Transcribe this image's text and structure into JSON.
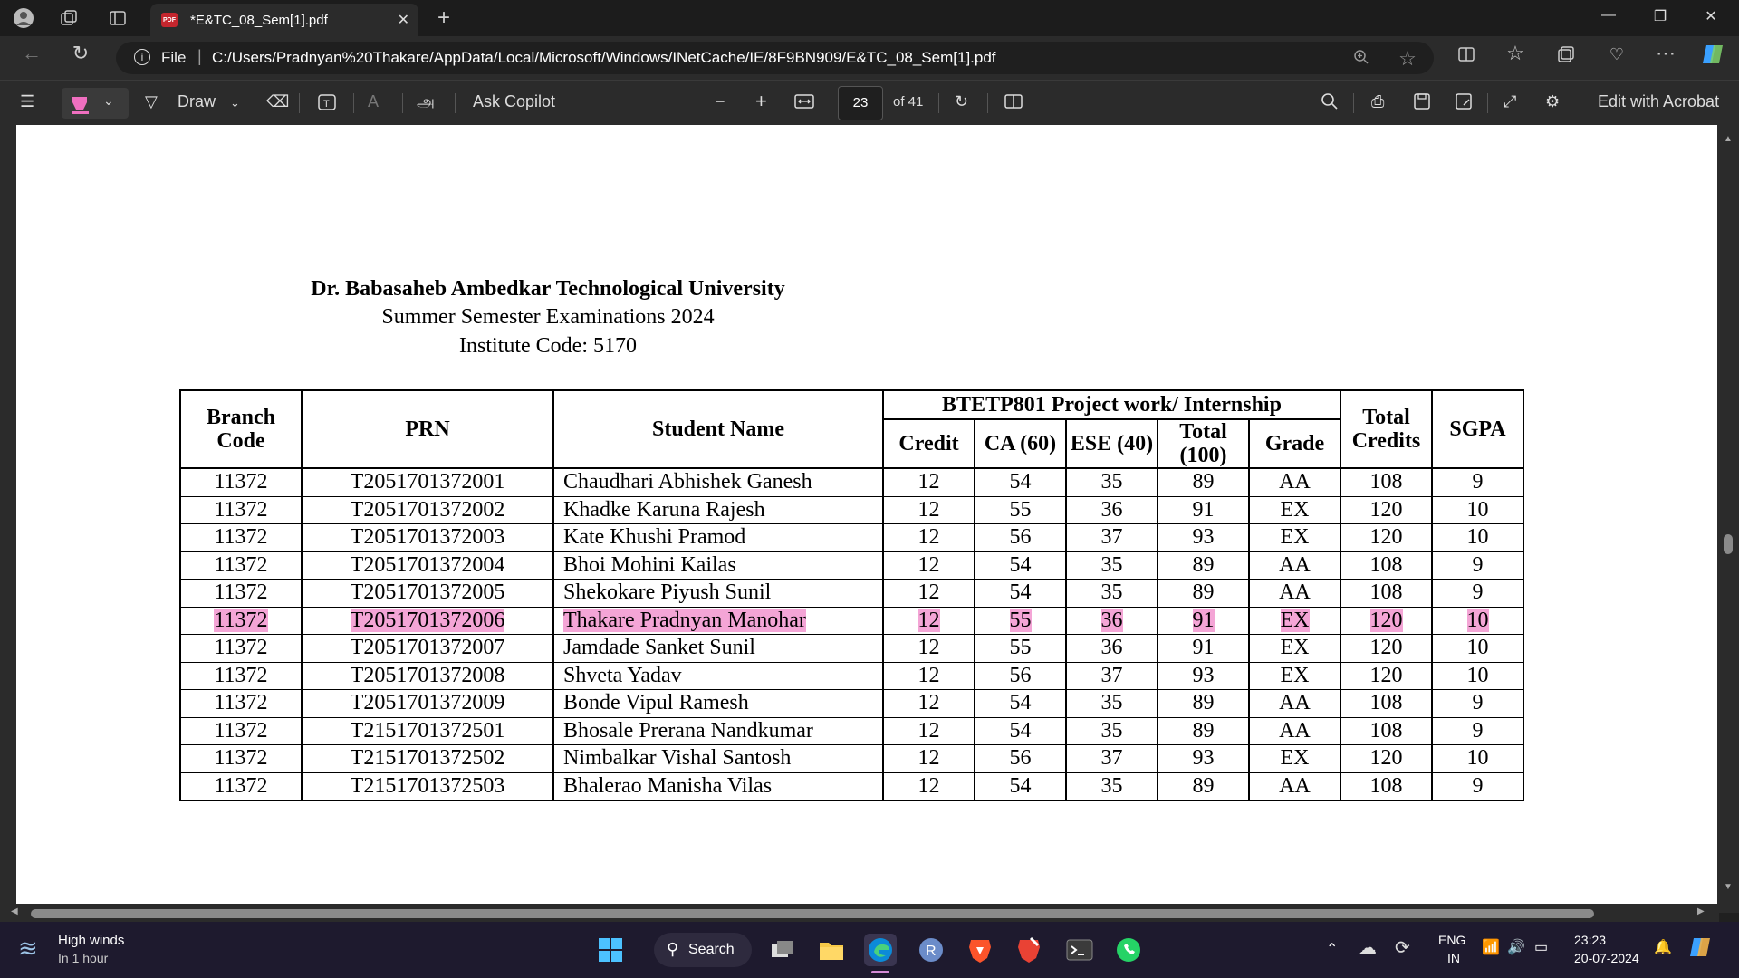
{
  "browser": {
    "tab_title": "*E&TC_08_Sem[1].pdf",
    "address_scheme_label": "File",
    "url": "C:/Users/Pradnyan%20Thakare/AppData/Local/Microsoft/Windows/INetCache/IE/8F9BN909/E&TC_08_Sem[1].pdf"
  },
  "pdf_toolbar": {
    "draw_label": "Draw",
    "ask_copilot_label": "Ask Copilot",
    "page_number": "23",
    "page_total": "of 41",
    "edit_acrobat_label": "Edit with Acrobat"
  },
  "document": {
    "title": "Dr. Babasaheb Ambedkar Technological University",
    "subtitle1": "Summer Semester Examinations 2024",
    "subtitle2": "Institute Code: 5170",
    "headers": {
      "branch_code": "Branch Code",
      "prn": "PRN",
      "student_name": "Student Name",
      "course": "BTETP801 Project work/ Internship",
      "credit": "Credit",
      "ca": "CA (60)",
      "ese": "ESE (40)",
      "total": "Total (100)",
      "grade": "Grade",
      "total_credits": "Total Credits",
      "sgpa": "SGPA"
    },
    "rows": [
      {
        "branch": "11372",
        "prn": "T2051701372001",
        "name": "Chaudhari Abhishek Ganesh",
        "credit": "12",
        "ca": "54",
        "ese": "35",
        "total": "89",
        "grade": "AA",
        "total_credits": "108",
        "sgpa": "9"
      },
      {
        "branch": "11372",
        "prn": "T2051701372002",
        "name": "Khadke Karuna Rajesh",
        "credit": "12",
        "ca": "55",
        "ese": "36",
        "total": "91",
        "grade": "EX",
        "total_credits": "120",
        "sgpa": "10"
      },
      {
        "branch": "11372",
        "prn": "T2051701372003",
        "name": "Kate Khushi Pramod",
        "credit": "12",
        "ca": "56",
        "ese": "37",
        "total": "93",
        "grade": "EX",
        "total_credits": "120",
        "sgpa": "10"
      },
      {
        "branch": "11372",
        "prn": "T2051701372004",
        "name": "Bhoi Mohini Kailas",
        "credit": "12",
        "ca": "54",
        "ese": "35",
        "total": "89",
        "grade": "AA",
        "total_credits": "108",
        "sgpa": "9"
      },
      {
        "branch": "11372",
        "prn": "T2051701372005",
        "name": "Shekokare Piyush Sunil",
        "credit": "12",
        "ca": "54",
        "ese": "35",
        "total": "89",
        "grade": "AA",
        "total_credits": "108",
        "sgpa": "9"
      },
      {
        "branch": "11372",
        "prn": "T2051701372006",
        "name": "Thakare Pradnyan Manohar",
        "credit": "12",
        "ca": "55",
        "ese": "36",
        "total": "91",
        "grade": "EX",
        "total_credits": "120",
        "sgpa": "10",
        "highlighted": true
      },
      {
        "branch": "11372",
        "prn": "T2051701372007",
        "name": "Jamdade Sanket Sunil",
        "credit": "12",
        "ca": "55",
        "ese": "36",
        "total": "91",
        "grade": "EX",
        "total_credits": "120",
        "sgpa": "10"
      },
      {
        "branch": "11372",
        "prn": "T2051701372008",
        "name": "Shveta Yadav",
        "credit": "12",
        "ca": "56",
        "ese": "37",
        "total": "93",
        "grade": "EX",
        "total_credits": "120",
        "sgpa": "10"
      },
      {
        "branch": "11372",
        "prn": "T2051701372009",
        "name": "Bonde Vipul Ramesh",
        "credit": "12",
        "ca": "54",
        "ese": "35",
        "total": "89",
        "grade": "AA",
        "total_credits": "108",
        "sgpa": "9"
      },
      {
        "branch": "11372",
        "prn": "T2151701372501",
        "name": "Bhosale Prerana Nandkumar",
        "credit": "12",
        "ca": "54",
        "ese": "35",
        "total": "89",
        "grade": "AA",
        "total_credits": "108",
        "sgpa": "9"
      },
      {
        "branch": "11372",
        "prn": "T2151701372502",
        "name": "Nimbalkar Vishal Santosh",
        "credit": "12",
        "ca": "56",
        "ese": "37",
        "total": "93",
        "grade": "EX",
        "total_credits": "120",
        "sgpa": "10"
      },
      {
        "branch": "11372",
        "prn": "T2151701372503",
        "name": "Bhalerao Manisha Vilas",
        "credit": "12",
        "ca": "54",
        "ese": "35",
        "total": "89",
        "grade": "AA",
        "total_credits": "108",
        "sgpa": "9"
      }
    ],
    "highlight_color": "#f4a5d6"
  },
  "taskbar": {
    "weather_title": "High winds",
    "weather_sub": "In 1 hour",
    "search_label": "Search",
    "lang_top": "ENG",
    "lang_bottom": "IN",
    "time": "23:23",
    "date": "20-07-2024"
  },
  "colors": {
    "chrome_dark": "#1c1c1c",
    "toolbar": "#2b2b2b",
    "taskbar": "#1e1a2e",
    "edge_accent": "#0078d4"
  }
}
